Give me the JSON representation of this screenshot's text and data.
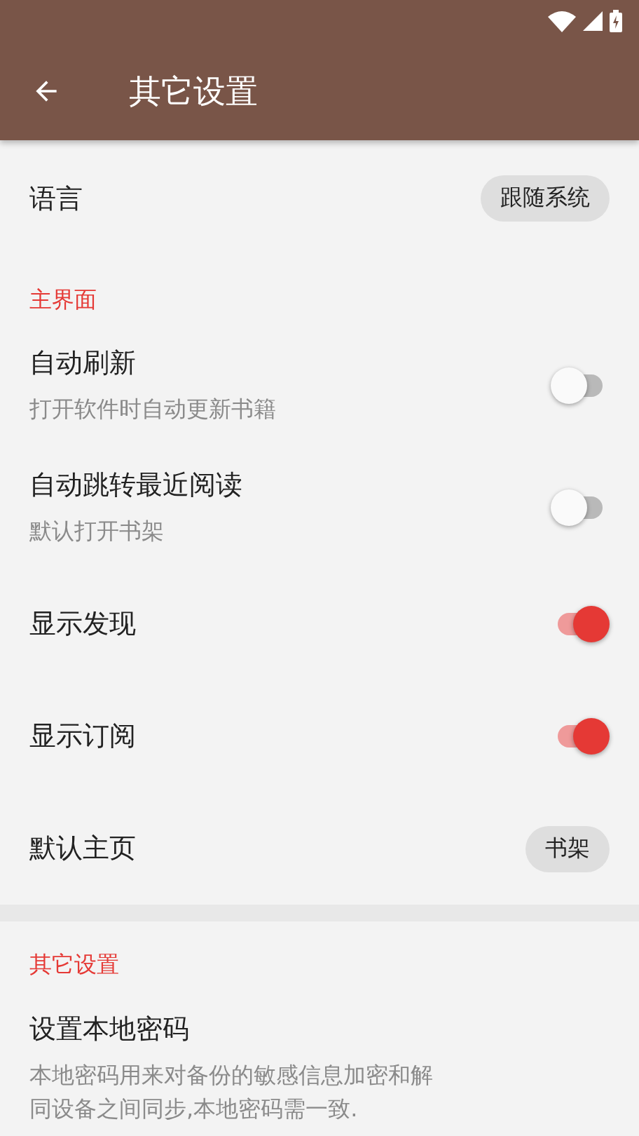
{
  "toolbar": {
    "title": "其它设置"
  },
  "sections": [
    {
      "items": [
        {
          "kind": "chip",
          "title": "语言",
          "value": "跟随系统"
        }
      ]
    },
    {
      "header": "主界面",
      "items": [
        {
          "kind": "switch",
          "title": "自动刷新",
          "summary": "打开软件时自动更新书籍",
          "on": false
        },
        {
          "kind": "switch",
          "title": "自动跳转最近阅读",
          "summary": "默认打开书架",
          "on": false
        },
        {
          "kind": "switch",
          "title": "显示发现",
          "on": true
        },
        {
          "kind": "switch",
          "title": "显示订阅",
          "on": true
        },
        {
          "kind": "chip",
          "title": "默认主页",
          "value": "书架"
        }
      ]
    },
    {
      "header": "其它设置",
      "items": [
        {
          "kind": "text",
          "title": "设置本地密码",
          "summary_lines": [
            "本地密码用来对备份的敏感信息加密和解",
            "同设备之间同步,本地密码需一致."
          ]
        }
      ]
    }
  ]
}
